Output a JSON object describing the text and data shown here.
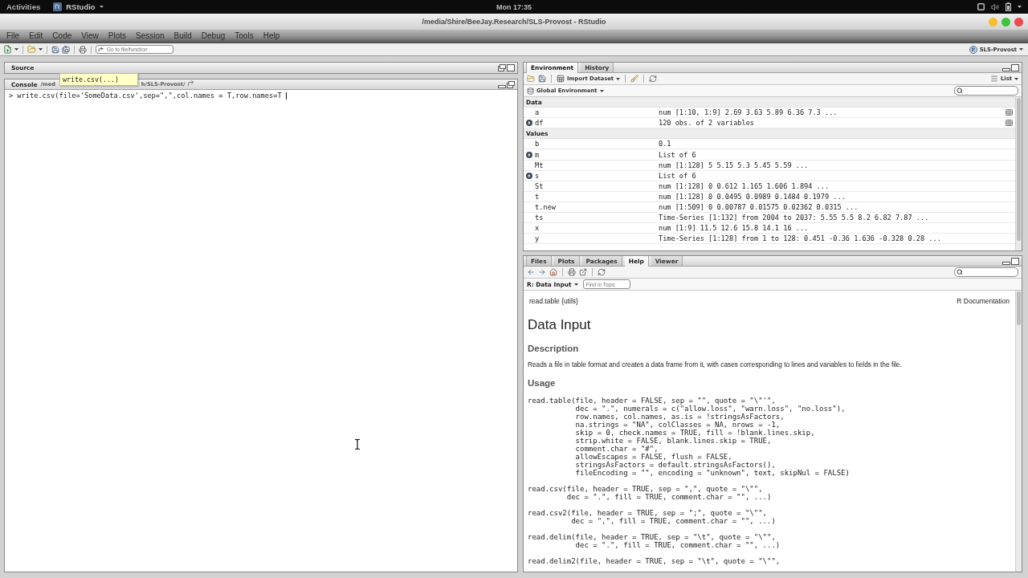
{
  "top_bar": {
    "activities": "Activities",
    "app": "RStudio",
    "clock": "Mon 17:35"
  },
  "window": {
    "title": "/media/Shire/BeeJay.Research/SLS-Provost - RStudio",
    "buttons": [
      {
        "color": "#f4c025"
      },
      {
        "color": "#3cc43c"
      },
      {
        "color": "#ec4a4f"
      }
    ]
  },
  "menu": [
    "File",
    "Edit",
    "Code",
    "View",
    "Plots",
    "Session",
    "Build",
    "Debug",
    "Tools",
    "Help"
  ],
  "toolbar": {
    "goto_placeholder": "Go to file/function",
    "project": "SLS-Provost"
  },
  "source_pane": {
    "title": "Source"
  },
  "console": {
    "title": "Console",
    "path_start": "/med",
    "path_end": "h/SLS-Provost/",
    "prompt": ">",
    "command": "write.csv(file='SomeData.csv',sep=\",\",col.names = T,row.names=T",
    "tooltip": "write.csv(...)"
  },
  "environment_pane": {
    "tabs": [
      {
        "label": "Environment",
        "selected": true
      },
      {
        "label": "History",
        "selected": false
      }
    ],
    "import_label": "Import Dataset",
    "view_mode": "List",
    "scope": "Global Environment",
    "sections": [
      {
        "title": "Data",
        "rows": [
          {
            "name": "a",
            "value": "num [1:10, 1:9] 2.69 3.63 5.89 6.36 7.3 ...",
            "expandable": false,
            "viewable": true
          },
          {
            "name": "df",
            "value": "120 obs. of 2 variables",
            "expandable": true,
            "viewable": true
          }
        ]
      },
      {
        "title": "Values",
        "rows": [
          {
            "name": "b",
            "value": "0.1",
            "expandable": false,
            "viewable": false
          },
          {
            "name": "m",
            "value": "List of 6",
            "expandable": true,
            "viewable": false
          },
          {
            "name": "Mt",
            "value": "num [1:128] 5 5.15 5.3 5.45 5.59 ...",
            "expandable": false,
            "viewable": false
          },
          {
            "name": "s",
            "value": "List of 6",
            "expandable": true,
            "viewable": false
          },
          {
            "name": "St",
            "value": "num [1:128] 0 0.612 1.165 1.606 1.894 ...",
            "expandable": false,
            "viewable": false
          },
          {
            "name": "t",
            "value": "num [1:128] 0 0.0495 0.0989 0.1484 0.1979 ...",
            "expandable": false,
            "viewable": false
          },
          {
            "name": "t.new",
            "value": "num [1:509] 0 0.00787 0.01575 0.02362 0.0315 ...",
            "expandable": false,
            "viewable": false
          },
          {
            "name": "ts",
            "value": "Time-Series [1:132] from 2004 to 2037: 5.55 5.5 8.2 6.82 7.87 ...",
            "expandable": false,
            "viewable": false
          },
          {
            "name": "x",
            "value": "num [1:9] 11.5 12.6 15.8 14.1 16 ...",
            "expandable": false,
            "viewable": false
          },
          {
            "name": "y",
            "value": "Time-Series [1:128] from 1 to 128: 0.451 -0.36 1.636 -0.328 0.28 ...",
            "expandable": false,
            "viewable": false
          }
        ]
      }
    ]
  },
  "help_pane": {
    "tabs": [
      {
        "label": "Files",
        "selected": false
      },
      {
        "label": "Plots",
        "selected": false
      },
      {
        "label": "Packages",
        "selected": false
      },
      {
        "label": "Help",
        "selected": true
      },
      {
        "label": "Viewer",
        "selected": false
      }
    ],
    "topic": "R: Data Input",
    "find_placeholder": "Find in Topic",
    "doc_label": "read.table {utils}",
    "doc_source": "R Documentation",
    "title": "Data Input",
    "sections": [
      {
        "heading": "Description",
        "kind": "paragraph",
        "text": "Reads a file in table format and creates a data frame from it, with cases corresponding to lines and variables to fields in the file."
      },
      {
        "heading": "Usage",
        "kind": "code",
        "blocks": [
          "read.table(file, header = FALSE, sep = \"\", quote = \"\\\"'\",\n           dec = \".\", numerals = c(\"allow.loss\", \"warn.loss\", \"no.loss\"),\n           row.names, col.names, as.is = !stringsAsFactors,\n           na.strings = \"NA\", colClasses = NA, nrows = -1,\n           skip = 0, check.names = TRUE, fill = !blank.lines.skip,\n           strip.white = FALSE, blank.lines.skip = TRUE,\n           comment.char = \"#\",\n           allowEscapes = FALSE, flush = FALSE,\n           stringsAsFactors = default.stringsAsFactors(),\n           fileEncoding = \"\", encoding = \"unknown\", text, skipNul = FALSE)",
          "read.csv(file, header = TRUE, sep = \",\", quote = \"\\\"\",\n         dec = \".\", fill = TRUE, comment.char = \"\", ...)",
          "read.csv2(file, header = TRUE, sep = \";\", quote = \"\\\"\",\n          dec = \",\", fill = TRUE, comment.char = \"\", ...)",
          "read.delim(file, header = TRUE, sep = \"\\t\", quote = \"\\\"\",\n           dec = \".\", fill = TRUE, comment.char = \"\", ...)",
          "read.delim2(file, header = TRUE, sep = \"\\t\", quote = \"\\\"\","
        ]
      }
    ]
  }
}
